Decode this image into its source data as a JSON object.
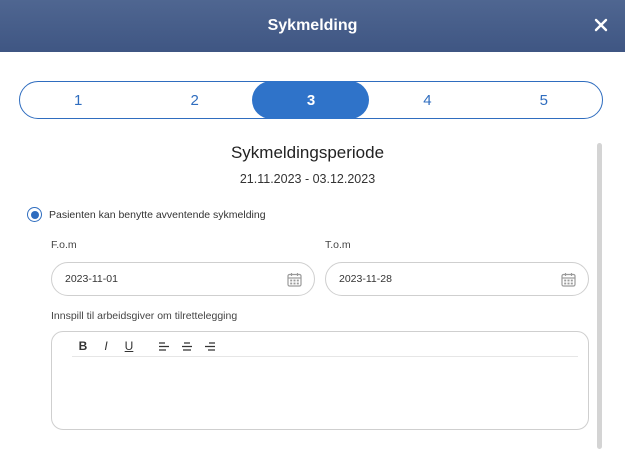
{
  "dialog": {
    "title": "Sykmelding"
  },
  "stepper": {
    "steps": [
      "1",
      "2",
      "3",
      "4",
      "5"
    ],
    "active_index": 2
  },
  "period": {
    "title": "Sykmeldingsperiode",
    "range": "21.11.2023 - 03.12.2023"
  },
  "option": {
    "label": "Pasienten kan benytte avventende sykmelding",
    "selected": true
  },
  "from": {
    "label": "F.o.m",
    "value": "2023-11-01"
  },
  "to": {
    "label": "T.o.m",
    "value": "2023-11-28"
  },
  "input_label": "Innspill til arbeidsgiver om tilrettelegging",
  "toolbar": {
    "bold": "B",
    "italic": "I",
    "underline": "U"
  },
  "colors": {
    "header": "#4a6088",
    "accent": "#2f6dbf",
    "active_step": "#2f73c9"
  },
  "icons": {
    "close": "close-icon",
    "calendar": "calendar-icon"
  }
}
